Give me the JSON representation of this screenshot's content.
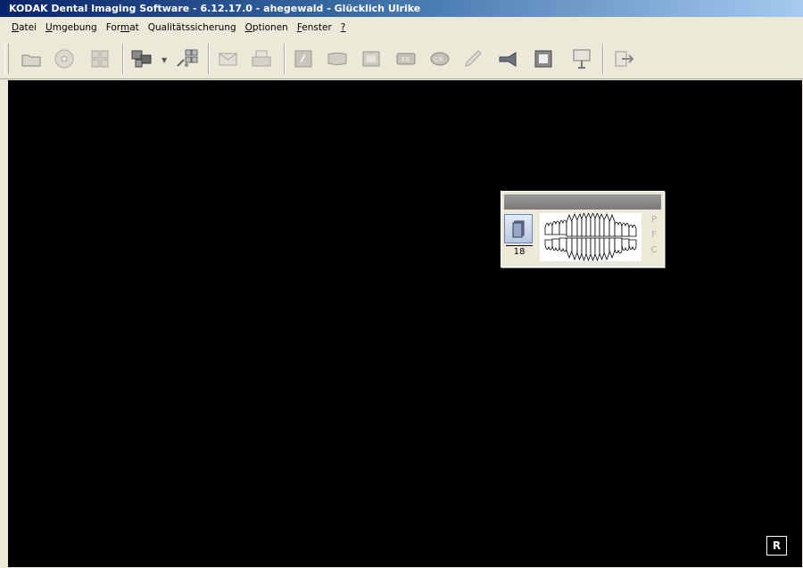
{
  "window": {
    "title": "KODAK Dental Imaging Software - 6.12.17.0 - ahegewald - Glücklich Ulrike"
  },
  "menu": [
    {
      "pre": "",
      "mn": "D",
      "post": "atei"
    },
    {
      "pre": "",
      "mn": "U",
      "post": "mgebung"
    },
    {
      "pre": "For",
      "mn": "m",
      "post": "at"
    },
    {
      "pre": "Qualitätssicherung",
      "mn": "",
      "post": ""
    },
    {
      "pre": "",
      "mn": "O",
      "post": "ptionen"
    },
    {
      "pre": "",
      "mn": "F",
      "post": "enster"
    },
    {
      "pre": "",
      "mn": "?",
      "post": ""
    }
  ],
  "toolbar": {
    "icons": [
      "open-folder-icon",
      "disc-icon",
      "acquire-icon",
      "window-layout-icon",
      "thumbnail-grid-icon",
      "email-icon",
      "print-icon",
      "intraoral-image-icon",
      "panoramic-icon",
      "camera-image-icon",
      "cephalometric-icon",
      "cr-icon",
      "pen-draw-icon",
      "send-icon",
      "frame-icon",
      "presentation-icon",
      "exit-icon"
    ]
  },
  "panel": {
    "image_count": "18",
    "side_letters": [
      "P",
      "F",
      "C"
    ]
  },
  "status": {
    "r_button": "R"
  },
  "colors": {
    "workspace": "#000000",
    "chrome": "#ece9d8",
    "titlebar": "#0a246a"
  }
}
